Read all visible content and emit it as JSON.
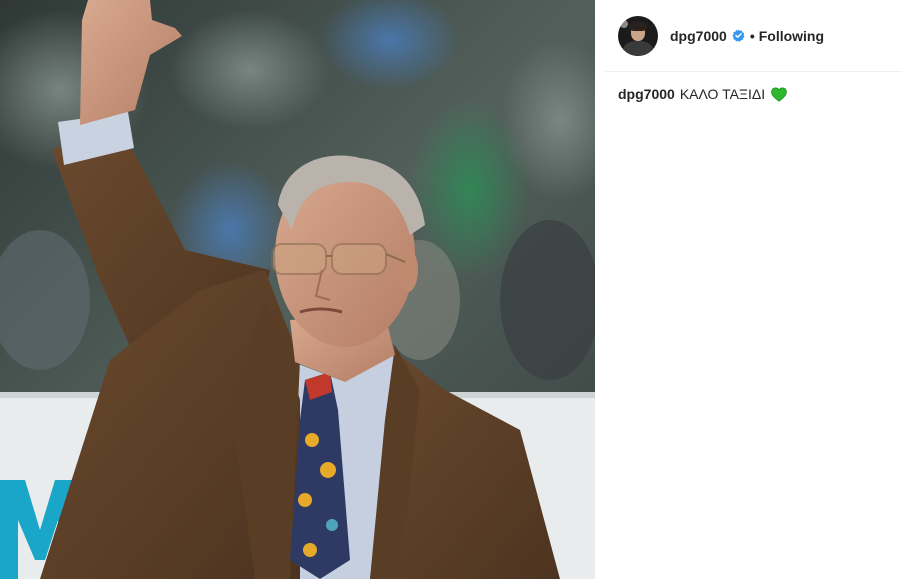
{
  "post": {
    "image": {
      "semantic": "photo-of-elderly-man-waving"
    },
    "header": {
      "username": "dpg7000",
      "verified_icon": "verified-badge-icon",
      "separator": "•",
      "follow_status": "Following"
    },
    "caption": {
      "username": "dpg7000",
      "text": "ΚΑΛΟ ΤΑΞΙΔΙ",
      "emoji_icon": "green-heart-icon"
    }
  },
  "colors": {
    "verified": "#3897f0",
    "heart": "#2db82d",
    "divider": "#efefef"
  }
}
